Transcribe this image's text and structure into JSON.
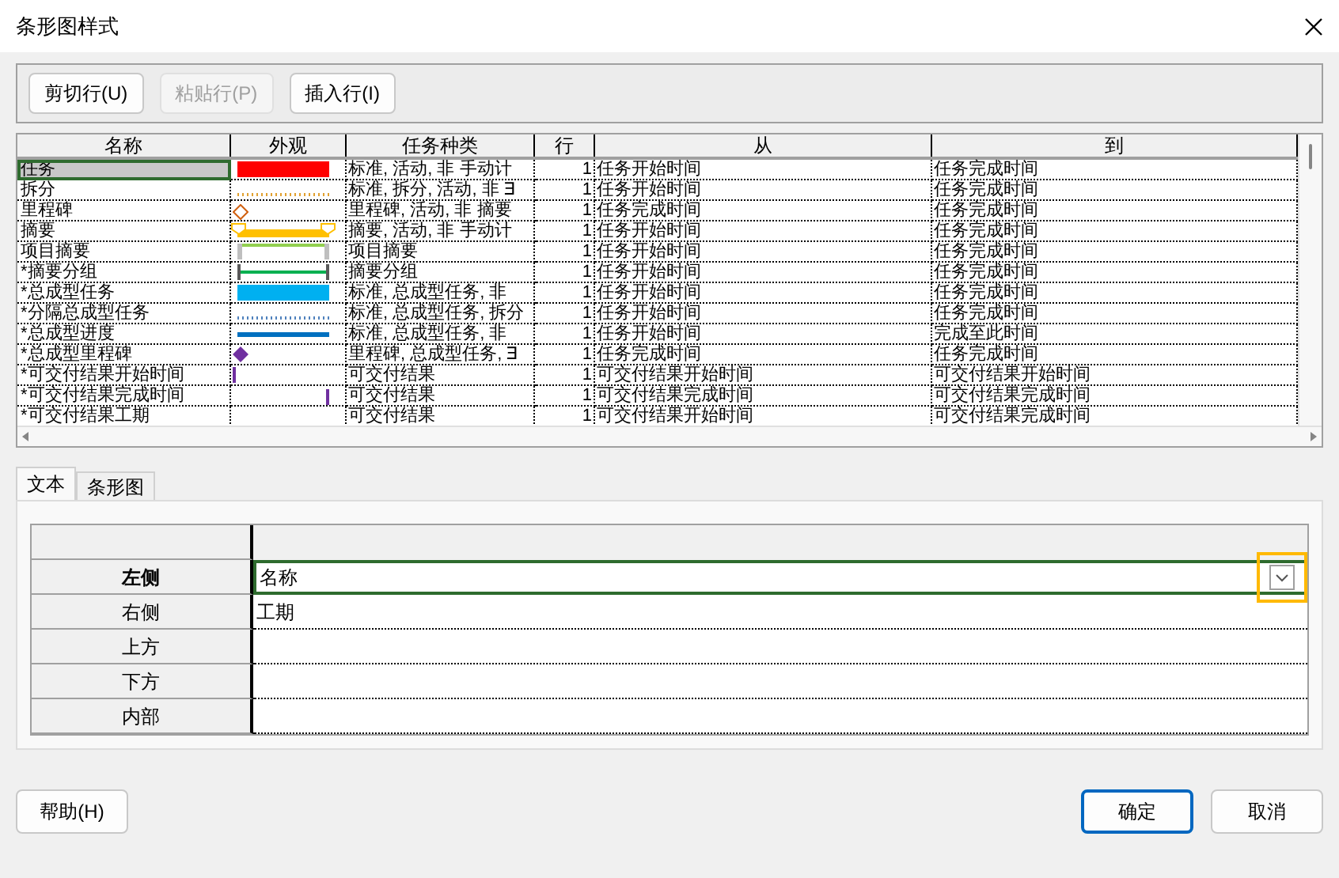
{
  "window": {
    "title": "条形图样式"
  },
  "toolbar": [
    {
      "label": "剪切行(U)",
      "disabled": false
    },
    {
      "label": "粘贴行(P)",
      "disabled": true
    },
    {
      "label": "插入行(I)",
      "disabled": false
    }
  ],
  "table": {
    "columns": [
      "名称",
      "外观",
      "任务种类",
      "行",
      "从",
      "到"
    ],
    "rows": [
      {
        "name": "任务",
        "selected": true,
        "appearance": {
          "kind": "bar",
          "color": "#ff0000"
        },
        "type": "标准, 活动, 非  手动计",
        "row": "1",
        "from": "任务开始时间",
        "to": "任务完成时间"
      },
      {
        "name": "拆分",
        "selected": false,
        "appearance": {
          "kind": "dotted",
          "color": "#e0a030"
        },
        "type": "标准, 拆分, 活动, 非  ∃",
        "row": "1",
        "from": "任务开始时间",
        "to": "任务完成时间"
      },
      {
        "name": "里程碑",
        "selected": false,
        "appearance": {
          "kind": "diamond-outline",
          "color": "#d06010"
        },
        "type": "里程碑, 活动, 非  摘要",
        "row": "1",
        "from": "任务完成时间",
        "to": "任务完成时间"
      },
      {
        "name": "摘要",
        "selected": false,
        "appearance": {
          "kind": "summary",
          "color": "#ffc000"
        },
        "type": "摘要, 活动, 非  手动计",
        "row": "1",
        "from": "任务开始时间",
        "to": "任务完成时间"
      },
      {
        "name": "项目摘要",
        "selected": false,
        "appearance": {
          "kind": "bracket",
          "color": "#92d050"
        },
        "type": "项目摘要",
        "row": "1",
        "from": "任务开始时间",
        "to": "任务完成时间"
      },
      {
        "name": "*摘要分组",
        "selected": false,
        "appearance": {
          "kind": "group",
          "color": "#00b050"
        },
        "type": "摘要分组",
        "row": "1",
        "from": "任务开始时间",
        "to": "任务完成时间"
      },
      {
        "name": "*总成型任务",
        "selected": false,
        "appearance": {
          "kind": "bar",
          "color": "#00b0f0"
        },
        "type": "标准, 总成型任务, 非",
        "row": "1",
        "from": "任务开始时间",
        "to": "任务完成时间"
      },
      {
        "name": "*分隔总成型任务",
        "selected": false,
        "appearance": {
          "kind": "dotted",
          "color": "#4f81bd"
        },
        "type": "标准, 总成型任务, 拆分",
        "row": "1",
        "from": "任务开始时间",
        "to": "任务完成时间"
      },
      {
        "name": "*总成型进度",
        "selected": false,
        "appearance": {
          "kind": "line",
          "color": "#0070c0"
        },
        "type": "标准, 总成型任务, 非",
        "row": "1",
        "from": "任务开始时间",
        "to": "完成至此时间"
      },
      {
        "name": "*总成型里程碑",
        "selected": false,
        "appearance": {
          "kind": "diamond",
          "color": "#7030a0"
        },
        "type": "里程碑, 总成型任务, ∃",
        "row": "1",
        "from": "任务完成时间",
        "to": "任务完成时间"
      },
      {
        "name": "*可交付结果开始时间",
        "selected": false,
        "appearance": {
          "kind": "start-mark",
          "color": "#7030a0"
        },
        "type": "可交付结果",
        "row": "1",
        "from": "可交付结果开始时间",
        "to": "可交付结果开始时间"
      },
      {
        "name": "*可交付结果完成时间",
        "selected": false,
        "appearance": {
          "kind": "finish-mark",
          "color": "#7030a0"
        },
        "type": "可交付结果",
        "row": "1",
        "from": "可交付结果完成时间",
        "to": "可交付结果完成时间"
      },
      {
        "name": "*可交付结果工期",
        "selected": false,
        "appearance": {
          "kind": "none"
        },
        "type": "可交付结果",
        "row": "1",
        "from": "可交付结果开始时间",
        "to": "可交付结果完成时间"
      }
    ]
  },
  "tabs": [
    {
      "label": "文本",
      "selected": true
    },
    {
      "label": "条形图",
      "selected": false
    }
  ],
  "text_positions": [
    {
      "label": "左侧",
      "value": "名称",
      "selected": true
    },
    {
      "label": "右侧",
      "value": "工期",
      "selected": false
    },
    {
      "label": "上方",
      "selected": false
    },
    {
      "label": "下方",
      "selected": false
    },
    {
      "label": "内部",
      "selected": false
    }
  ],
  "buttons": [
    {
      "label": "帮助(H)",
      "kind": "normal"
    },
    {
      "label": "确定",
      "kind": "default"
    },
    {
      "label": "取消",
      "kind": "normal"
    }
  ]
}
